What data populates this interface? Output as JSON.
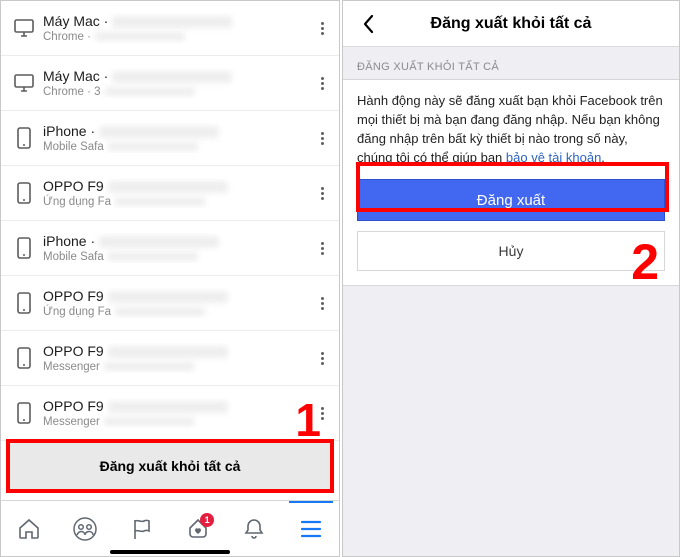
{
  "annotations": {
    "step1": "1",
    "step2": "2"
  },
  "left": {
    "logout_all_label": "Đăng xuất khỏi tất cả",
    "devices": [
      {
        "icon": "desktop",
        "title": "Máy Mac ·",
        "sub": "Chrome ·"
      },
      {
        "icon": "desktop",
        "title": "Máy Mac ·",
        "sub": "Chrome · 3"
      },
      {
        "icon": "phone",
        "title": "iPhone ·",
        "sub": "Mobile Safa"
      },
      {
        "icon": "phone",
        "title": "OPPO F9",
        "sub": "Ứng dụng Fa"
      },
      {
        "icon": "phone",
        "title": "iPhone ·",
        "sub": "Mobile Safa"
      },
      {
        "icon": "phone",
        "title": "OPPO F9",
        "sub": "Ứng dụng Fa"
      },
      {
        "icon": "phone",
        "title": "OPPO F9",
        "sub": "Messenger"
      },
      {
        "icon": "phone",
        "title": "OPPO F9",
        "sub": "Messenger"
      }
    ],
    "tabbar": {
      "home": "home-icon",
      "groups": "groups-icon",
      "pages": "flag-icon",
      "dating": "heart-icon",
      "notifications": "bell-icon",
      "menu": "menu-icon",
      "badge": "1",
      "active": "menu"
    }
  },
  "right": {
    "header_title": "Đăng xuất khỏi tất cả",
    "section_label": "ĐĂNG XUẤT KHỎI TẤT CẢ",
    "message_pre": "Hành động này sẽ đăng xuất bạn khỏi Facebook trên mọi thiết bị mà bạn đang đăng nhập. Nếu bạn không đăng nhập trên bất kỳ thiết bị nào trong số này, chúng tôi có thể giúp bạn ",
    "message_link": "bảo vệ tài khoản",
    "message_post": ".",
    "btn_primary": "Đăng xuất",
    "btn_cancel": "Hủy"
  }
}
